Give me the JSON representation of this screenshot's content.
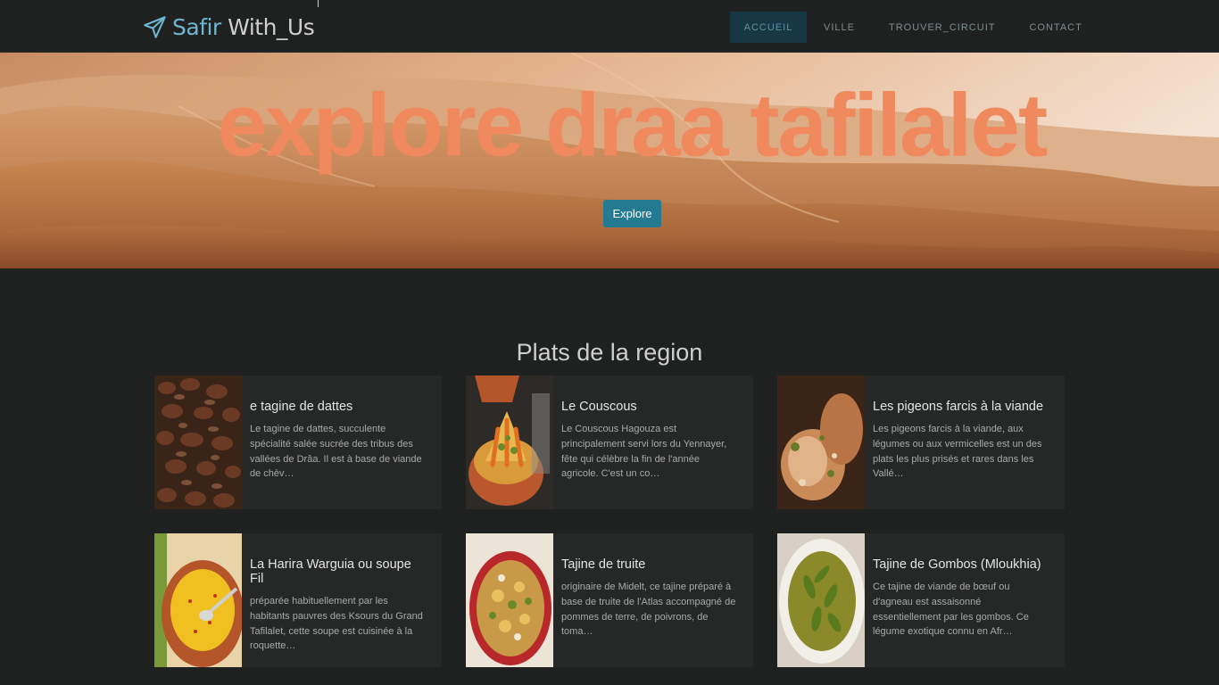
{
  "brand": {
    "part1": "Safir",
    "part2": "With_Us"
  },
  "nav": [
    {
      "label": "ACCUEIL",
      "active": true
    },
    {
      "label": "VILLE",
      "active": false
    },
    {
      "label": "TROUVER_CIRCUIT",
      "active": false
    },
    {
      "label": "CONTACT",
      "active": false
    }
  ],
  "hero": {
    "title": "explore draa tafilalet",
    "button": "Explore"
  },
  "section": {
    "title": "Plats de la region"
  },
  "dishes": [
    {
      "title": "e tagine de dattes",
      "text": "Le tagine de dattes, succulente spécialité salée sucrée des tribus des vallées de Drâa. Il est à base de viande de chèv…"
    },
    {
      "title": "Le Couscous",
      "text": "Le Couscous Hagouza est principalement servi lors du Yennayer, fête qui célèbre la fin de l'année agricole. C'est un co…"
    },
    {
      "title": "Les pigeons farcis à la viande",
      "text": "Les pigeons farcis à la viande, aux légumes ou aux vermicelles est un des plats les plus prisés et rares dans les Vallé…"
    },
    {
      "title": "La Harira Warguia ou soupe Fil",
      "text": "préparée habituellement par les habitants pauvres des Ksours du Grand Tafilalet, cette soupe est cuisinée à la roquette…"
    },
    {
      "title": "Tajine de truite",
      "text": "originaire de Midelt, ce tajine préparé à base de truite de l'Atlas accompagné de pommes de terre, de poivrons, de toma…"
    },
    {
      "title": "Tajine de Gombos (Mloukhia)",
      "text": "Ce tajine de viande de bœuf ou d'agneau est assaisonné essentiellement par les gombos. Ce légume exotique connu en Afr…"
    }
  ],
  "colors": {
    "accent": "#6fb6d0",
    "hero_title": "#f08a5e",
    "button": "#237a91",
    "background": "#1f2121",
    "card": "#262828"
  },
  "icons": {
    "brand": "paper-plane-icon"
  }
}
